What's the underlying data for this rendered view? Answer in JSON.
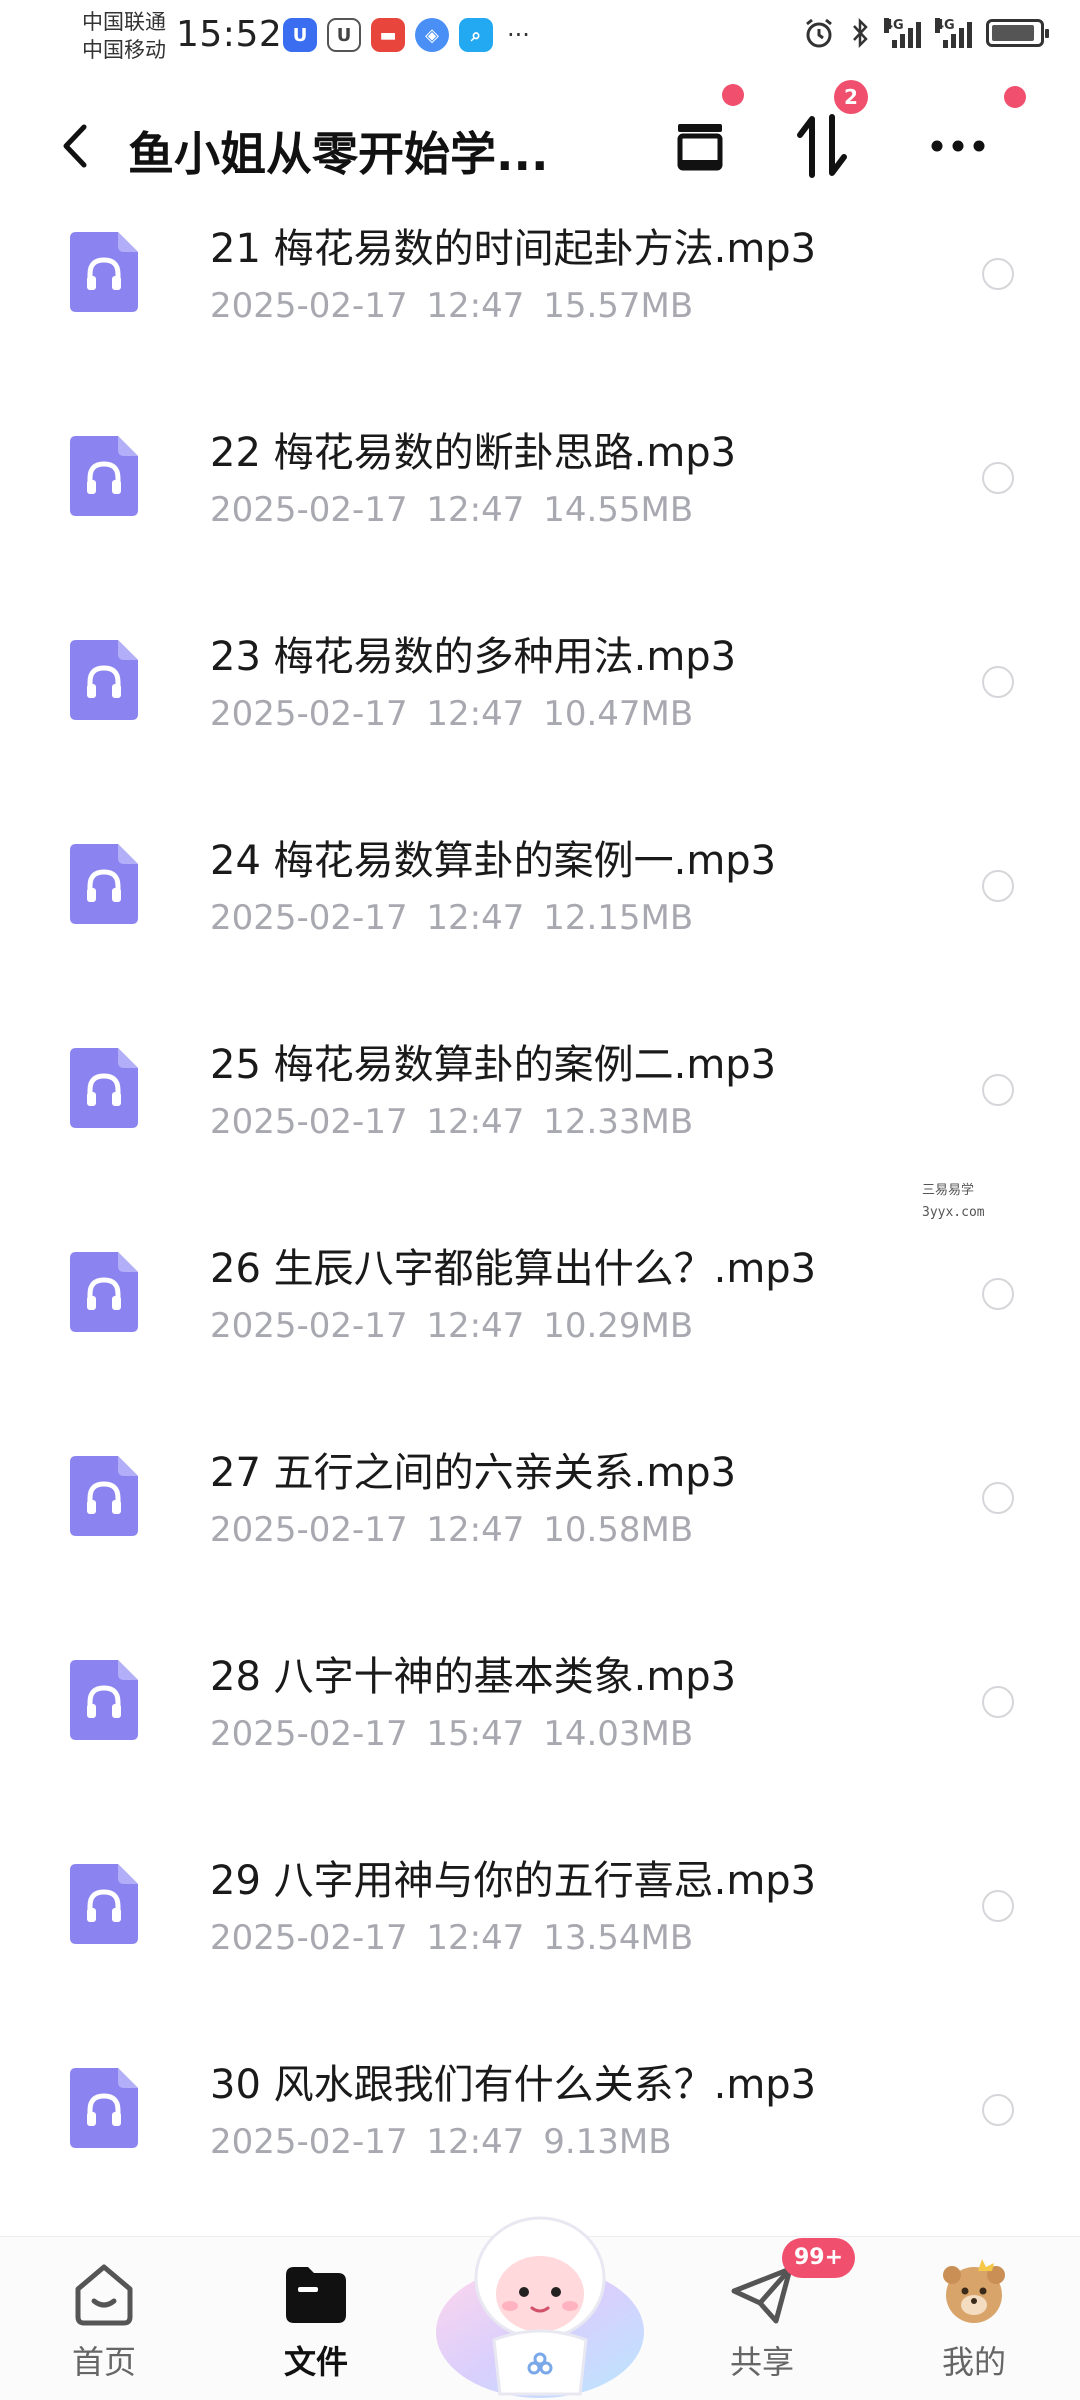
{
  "status_bar": {
    "carrier_1": "中国联通",
    "carrier_2": "中国移动",
    "time": "15:52",
    "network_1": "4G",
    "network_2": "4G",
    "more": "···"
  },
  "header": {
    "title": "鱼小姐从零开始学...",
    "transfer_badge": "2"
  },
  "files": [
    {
      "name": "21 梅花易数的时间起卦方法.mp3",
      "date": "2025-02-17",
      "time": "12:47",
      "size": "15.57MB"
    },
    {
      "name": "22 梅花易数的断卦思路.mp3",
      "date": "2025-02-17",
      "time": "12:47",
      "size": "14.55MB"
    },
    {
      "name": "23 梅花易数的多种用法.mp3",
      "date": "2025-02-17",
      "time": "12:47",
      "size": "10.47MB"
    },
    {
      "name": "24 梅花易数算卦的案例一.mp3",
      "date": "2025-02-17",
      "time": "12:47",
      "size": "12.15MB"
    },
    {
      "name": "25 梅花易数算卦的案例二.mp3",
      "date": "2025-02-17",
      "time": "12:47",
      "size": "12.33MB"
    },
    {
      "name": "26 生辰八字都能算出什么？.mp3",
      "date": "2025-02-17",
      "time": "12:47",
      "size": "10.29MB"
    },
    {
      "name": "27 五行之间的六亲关系.mp3",
      "date": "2025-02-17",
      "time": "12:47",
      "size": "10.58MB"
    },
    {
      "name": "28 八字十神的基本类象.mp3",
      "date": "2025-02-17",
      "time": "15:47",
      "size": "14.03MB"
    },
    {
      "name": "29 八字用神与你的五行喜忌.mp3",
      "date": "2025-02-17",
      "time": "12:47",
      "size": "13.54MB"
    },
    {
      "name": "30 风水跟我们有什么关系？.mp3",
      "date": "2025-02-17",
      "time": "12:47",
      "size": "9.13MB"
    }
  ],
  "watermark": {
    "line1": "三易易学",
    "line2": "3yyx.com"
  },
  "bottom_nav": {
    "home": "首页",
    "files": "文件",
    "share": "共享",
    "share_badge": "99+",
    "mine": "我的"
  },
  "colors": {
    "accent": "#8b84f0",
    "badge": "#f0506e",
    "meta_text": "#a8a8b0"
  }
}
